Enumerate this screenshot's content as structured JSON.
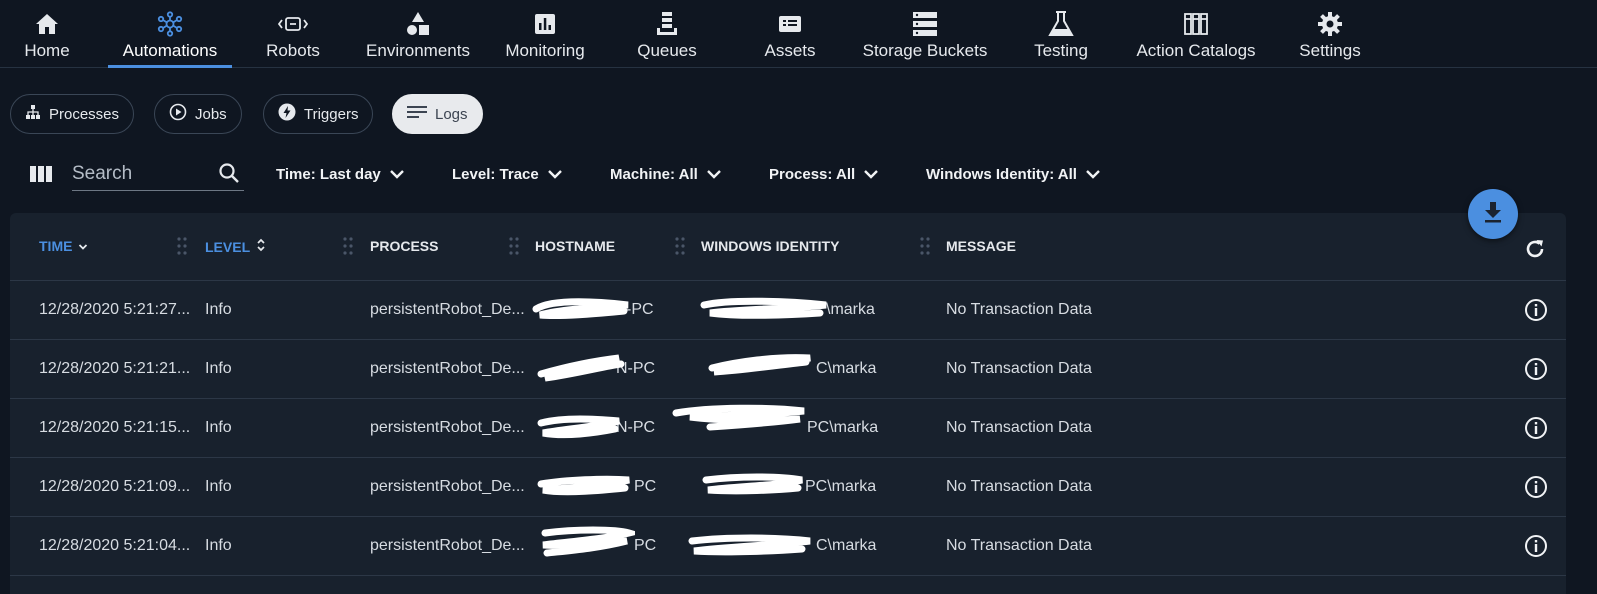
{
  "colors": {
    "background": "#0f1621",
    "table_background": "#18212d",
    "accent": "#4b8fe0",
    "text": "#e6e9ed"
  },
  "nav": {
    "items": [
      {
        "label": "Home",
        "icon": "home-icon"
      },
      {
        "label": "Automations",
        "icon": "automations-icon",
        "active": true
      },
      {
        "label": "Robots",
        "icon": "robot-icon"
      },
      {
        "label": "Environments",
        "icon": "environments-icon"
      },
      {
        "label": "Monitoring",
        "icon": "monitoring-icon"
      },
      {
        "label": "Queues",
        "icon": "queues-icon"
      },
      {
        "label": "Assets",
        "icon": "assets-icon"
      },
      {
        "label": "Storage Buckets",
        "icon": "storage-icon"
      },
      {
        "label": "Testing",
        "icon": "flask-icon"
      },
      {
        "label": "Action Catalogs",
        "icon": "catalog-icon"
      },
      {
        "label": "Settings",
        "icon": "gear-icon"
      }
    ]
  },
  "subtabs": [
    {
      "label": "Processes",
      "icon": "hierarchy-icon"
    },
    {
      "label": "Jobs",
      "icon": "play-circle-icon"
    },
    {
      "label": "Triggers",
      "icon": "lightning-icon"
    },
    {
      "label": "Logs",
      "icon": "lines-icon",
      "active": true
    }
  ],
  "search": {
    "placeholder": "Search"
  },
  "filters": {
    "time": "Time: Last day",
    "level": "Level: Trace",
    "machine": "Machine: All",
    "process": "Process: All",
    "windows_identity": "Windows Identity: All"
  },
  "table": {
    "columns": {
      "time": "TIME",
      "level": "LEVEL",
      "process": "PROCESS",
      "hostname": "HOSTNAME",
      "windows_identity": "WINDOWS IDENTITY",
      "message": "MESSAGE"
    },
    "rows": [
      {
        "time": "12/28/2020 5:21:27...",
        "level": "Info",
        "process": "persistentRobot_De...",
        "hostname": "-PC",
        "windows_identity": "\\marka",
        "message": "No Transaction Data"
      },
      {
        "time": "12/28/2020 5:21:21...",
        "level": "Info",
        "process": "persistentRobot_De...",
        "hostname": "N-PC",
        "windows_identity": "C\\marka",
        "message": "No Transaction Data"
      },
      {
        "time": "12/28/2020 5:21:15...",
        "level": "Info",
        "process": "persistentRobot_De...",
        "hostname": "N-PC",
        "windows_identity": "PC\\marka",
        "message": "No Transaction Data"
      },
      {
        "time": "12/28/2020 5:21:09...",
        "level": "Info",
        "process": "persistentRobot_De...",
        "hostname": "PC",
        "windows_identity": "PC\\marka",
        "message": "No Transaction Data"
      },
      {
        "time": "12/28/2020 5:21:04...",
        "level": "Info",
        "process": "persistentRobot_De...",
        "hostname": "PC",
        "windows_identity": "C\\marka",
        "message": "No Transaction Data"
      }
    ]
  }
}
